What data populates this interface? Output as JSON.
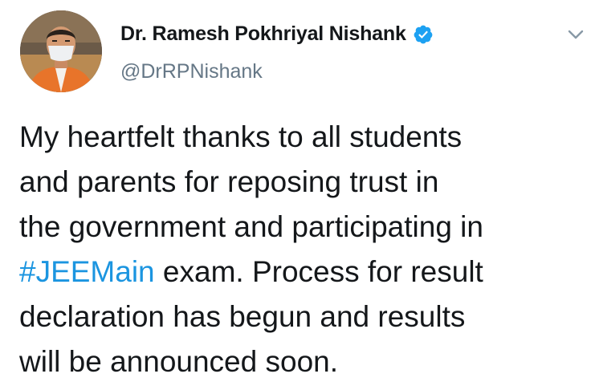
{
  "author": {
    "display_name": "Dr. Ramesh Pokhriyal Nishank",
    "handle": "@DrRPNishank",
    "verified": true
  },
  "tweet": {
    "line1": "My heartfelt thanks to all students",
    "line2": "and parents for reposing trust in",
    "line3": "the government and participating in",
    "hashtag": "#JEEMain",
    "line4_rest": " exam. Process for result",
    "line5": "declaration has begun and results",
    "line6": "will be announced soon."
  },
  "icons": {
    "verified": "verified-badge-icon",
    "menu": "chevron-down-icon"
  },
  "colors": {
    "text": "#14171a",
    "secondary": "#657786",
    "link": "#1b95e0",
    "verified": "#1da1f2"
  }
}
